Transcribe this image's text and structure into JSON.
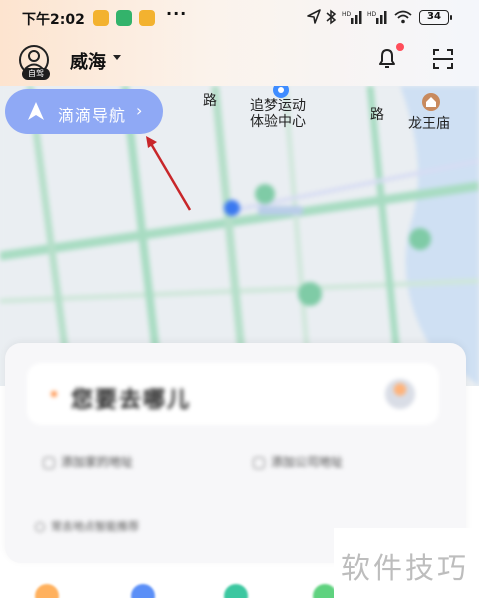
{
  "status_bar": {
    "time": "下午2:02",
    "more": "···",
    "battery": "34"
  },
  "header": {
    "avatar_badge": "自驾",
    "city": "威海"
  },
  "map": {
    "poi_sports": "追梦运动\n体验中心",
    "poi_temple": "龙王庙",
    "road_left": "路",
    "road_right": "路"
  },
  "nav_button": {
    "label": "滴滴导航",
    "chevron": "›"
  },
  "panel": {
    "search_placeholder": "您要去哪儿",
    "shortcut_home": "添加家的地址",
    "shortcut_company": "添加公司地址",
    "hint": "常去地点智能推荐"
  },
  "watermark": "软件技巧",
  "colors": {
    "accent_blue": "#8fa9f5",
    "badge_red": "#ff4d5a",
    "arrow_red": "#c8262a",
    "road_green": "#8fd6b0"
  }
}
